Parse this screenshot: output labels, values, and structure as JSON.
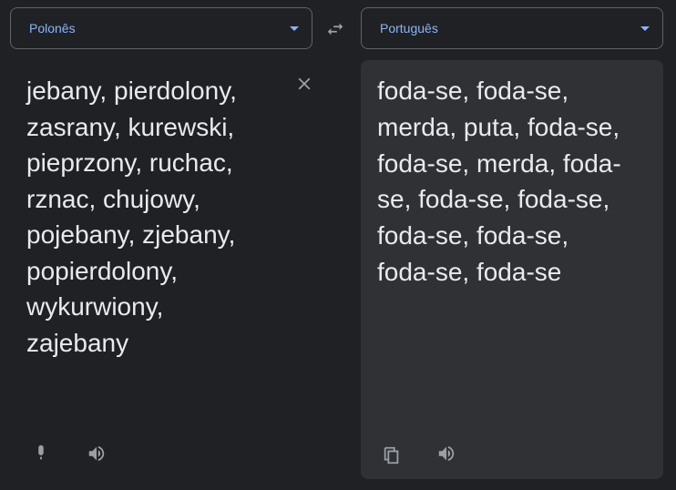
{
  "source": {
    "language": "Polonês",
    "text": "jebany, pierdolony,\nzasrany, kurewski,\npieprzony, ruchac,\nrznac, chujowy,\npojebany, zjebany,\npopierdolony,\nwykurwiony,\nzajebany"
  },
  "target": {
    "language": "Português",
    "text": "foda-se, foda-se,\nmerda, puta, foda-se,\nfoda-se, merda, foda-\nse, foda-se, foda-se,\nfoda-se, foda-se,\nfoda-se, foda-se"
  },
  "icons": {
    "swap": "swap-horizontal-icon",
    "clear": "close-icon",
    "mic": "microphone-icon",
    "source_listen": "speaker-icon",
    "copy": "copy-icon",
    "target_listen": "speaker-icon"
  },
  "colors": {
    "background": "#202124",
    "panel": "#303134",
    "accent": "#8ab4f8",
    "text": "#e8eaed",
    "icon": "#9aa0a6"
  }
}
